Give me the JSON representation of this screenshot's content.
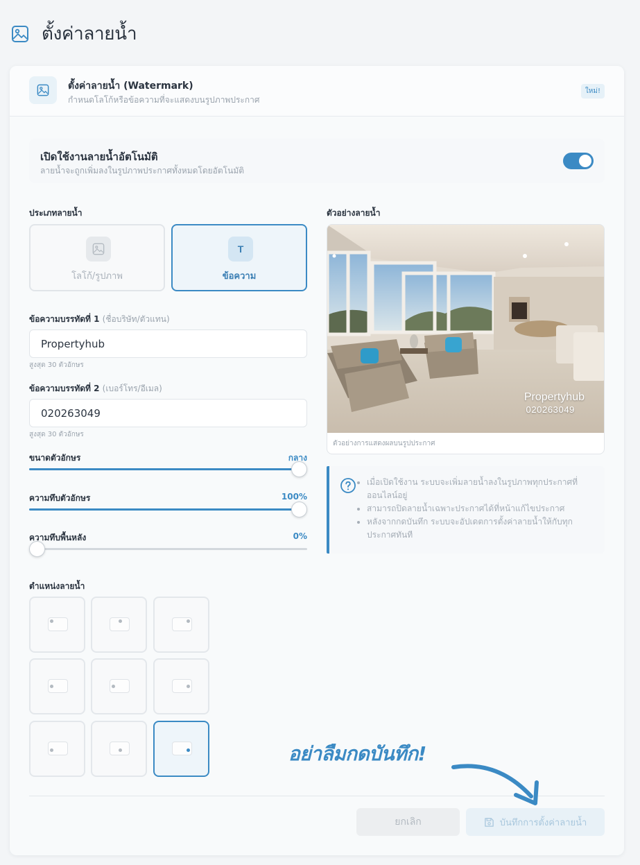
{
  "page": {
    "title": "ตั้งค่าลายน้ำ"
  },
  "card": {
    "title": "ตั้งค่าลายน้ำ (Watermark)",
    "subtitle": "กำหนดโลโก้หรือข้อความที่จะแสดงบนรูปภาพประกาศ",
    "badge": "ใหม่!"
  },
  "auto_toggle": {
    "title": "เปิดใช้งานลายน้ำอัตโนมัติ",
    "subtitle": "ลายน้ำจะถูกเพิ่มลงในรูปภาพประกาศทั้งหมดโดยอัตโนมัติ",
    "enabled": true
  },
  "watermark_type": {
    "label": "ประเภทลายน้ำ",
    "options": [
      {
        "label": "โลโก้/รูปภาพ",
        "icon": "image-icon",
        "selected": false
      },
      {
        "label": "ข้อความ",
        "icon": "text-icon",
        "glyph": "T",
        "selected": true
      }
    ]
  },
  "line1": {
    "label": "ข้อความบรรทัดที่ 1",
    "hint": "(ชื่อบริษัท/ตัวแทน)",
    "value": "Propertyhub",
    "helper": "สูงสุด 30 ตัวอักษร"
  },
  "line2": {
    "label": "ข้อความบรรทัดที่ 2",
    "hint": "(เบอร์โทร/อีเมล)",
    "value": "020263049",
    "helper": "สูงสุด 30 ตัวอักษร"
  },
  "sliders": [
    {
      "label": "ขนาดตัวอักษร",
      "value_text": "กลาง",
      "level": 1.0
    },
    {
      "label": "ความทึบตัวอักษร",
      "value_text": "100%",
      "level": 1.0
    },
    {
      "label": "ความทึบพื้นหลัง",
      "value_text": "0%",
      "level": 0.0
    }
  ],
  "position": {
    "label": "ตำแหน่งลายน้ำ",
    "selected": "bottom-right",
    "cells": [
      "top-left",
      "top-center",
      "top-right",
      "middle-left",
      "center",
      "middle-right",
      "bottom-left",
      "bottom-center",
      "bottom-right"
    ]
  },
  "preview": {
    "label": "ตัวอย่างลายน้ำ",
    "watermark_line1": "Propertyhub",
    "watermark_line2": "020263049",
    "caption": "ตัวอย่างการแสดงผลบนรูปประกาศ"
  },
  "info": {
    "items": [
      "เมื่อเปิดใช้งาน ระบบจะเพิ่มลายน้ำลงในรูปภาพทุกประกาศที่ออนไลน์อยู่",
      "สามารถปิดลายน้ำเฉพาะประกาศได้ที่หน้าแก้ไขประกาศ",
      "หลังจากกดบันทึก ระบบจะอัปเดตการตั้งค่าลายน้ำให้กับทุกประกาศทันที"
    ]
  },
  "actions": {
    "cancel_label": "ยกเลิก",
    "save_label": "บันทึกการตั้งค่าลายน้ำ"
  },
  "annotation": {
    "text": "อย่าลืมกดบันทึก!"
  },
  "colors": {
    "accent": "#3b8ac4",
    "text": "#2b3440",
    "muted": "#9aa3ad"
  }
}
